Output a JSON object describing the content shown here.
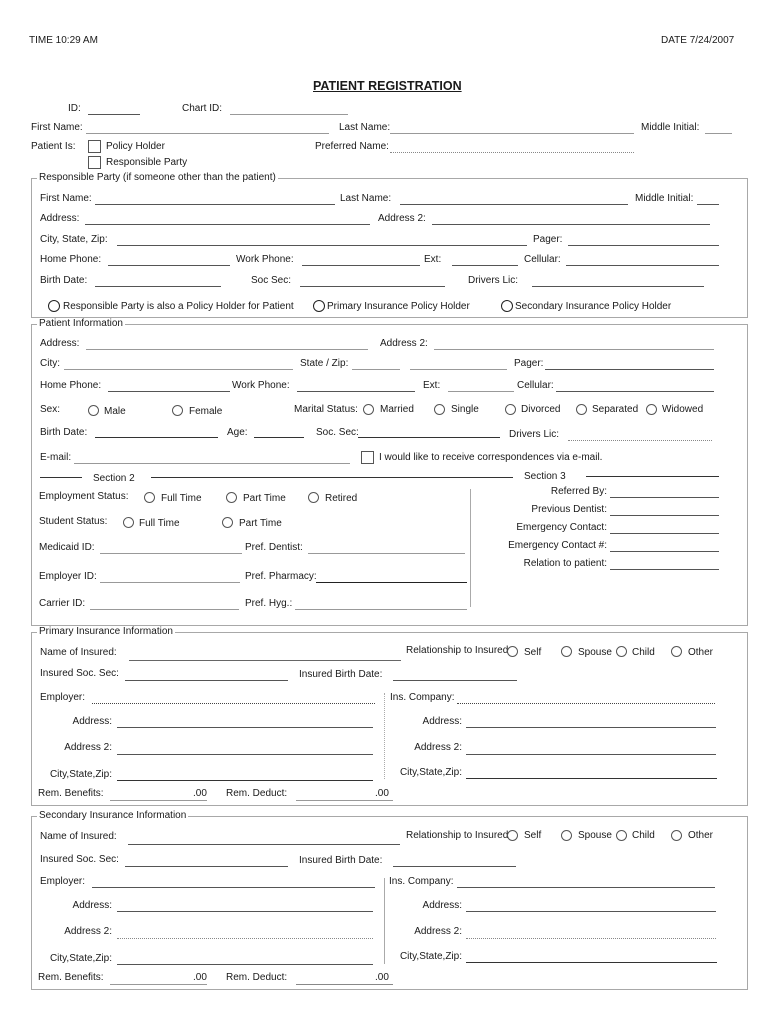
{
  "header": {
    "time": "TIME  10:29 AM",
    "date": "DATE  7/24/2007",
    "title": "PATIENT REGISTRATION"
  },
  "top": {
    "id": "ID:",
    "chart_id": "Chart ID:",
    "first_name": "First Name:",
    "last_name": "Last Name:",
    "middle_initial": "Middle Initial:",
    "patient_is": "Patient Is:",
    "policy_holder": "Policy Holder",
    "responsible_party": "Responsible Party",
    "preferred_name": "Preferred Name:"
  },
  "responsible": {
    "legend": "Responsible Party (if someone other than the patient)",
    "first_name": "First Name:",
    "last_name": "Last Name:",
    "middle_initial": "Middle Initial:",
    "address": "Address:",
    "address2": "Address 2:",
    "city_state_zip": "City, State, Zip:",
    "pager": "Pager:",
    "home_phone": "Home Phone:",
    "work_phone": "Work Phone:",
    "ext": "Ext:",
    "cellular": "Cellular:",
    "birth_date": "Birth Date:",
    "soc_sec": "Soc Sec:",
    "drivers_lic": "Drivers Lic:",
    "options": [
      "Responsible Party is also a Policy Holder for Patient",
      "Primary Insurance Policy Holder",
      "Secondary Insurance Policy Holder"
    ]
  },
  "patient": {
    "legend": "Patient Information",
    "address": "Address:",
    "address2": "Address 2:",
    "city": "City:",
    "state_zip": "State / Zip:",
    "pager": "Pager:",
    "home_phone": "Home Phone:",
    "work_phone": "Work Phone:",
    "ext": "Ext:",
    "cellular": "Cellular:",
    "sex": "Sex:",
    "sex_options": [
      "Male",
      "Female"
    ],
    "marital_status": "Marital Status:",
    "marital_options": [
      "Married",
      "Single",
      "Divorced",
      "Separated",
      "Widowed"
    ],
    "birth_date": "Birth Date:",
    "age": "Age:",
    "soc_sec": "Soc. Sec:",
    "drivers_lic": "Drivers Lic:",
    "email": "E-mail:",
    "email_opt_in": "I would like to receive correspondences via e-mail."
  },
  "section2": {
    "title": "Section 2",
    "employment_status": "Employment Status:",
    "employment_options": [
      "Full Time",
      "Part Time",
      "Retired"
    ],
    "student_status": "Student Status:",
    "student_options": [
      "Full Time",
      "Part Time"
    ],
    "medicaid_id": "Medicaid ID:",
    "pref_dentist": "Pref. Dentist:",
    "employer_id": "Employer ID:",
    "pref_pharmacy": "Pref. Pharmacy:",
    "carrier_id": "Carrier ID:",
    "pref_hyg": "Pref. Hyg.:"
  },
  "section3": {
    "title": "Section 3",
    "referred_by": "Referred By:",
    "previous_dentist": "Previous Dentist:",
    "emergency_contact": "Emergency Contact:",
    "emergency_contact_num": "Emergency Contact #:",
    "relation": "Relation to patient:"
  },
  "primary": {
    "legend": "Primary Insurance Information",
    "name_of_insured": "Name of Insured:",
    "relationship": "Relationship to Insured:",
    "rel_options": [
      "Self",
      "Spouse",
      "Child",
      "Other"
    ],
    "insured_soc_sec": "Insured Soc. Sec:",
    "insured_birth_date": "Insured Birth Date:",
    "employer": "Employer:",
    "address": "Address:",
    "address2": "Address 2:",
    "city_state_zip": "City,State,Zip:",
    "ins_company": "Ins. Company:",
    "ins_address": "Address:",
    "ins_address2": "Address 2:",
    "ins_city_state_zip": "City,State,Zip:",
    "rem_benefits": "Rem. Benefits:",
    "rem_benefits_value": ".00",
    "rem_deduct": "Rem. Deduct:",
    "rem_deduct_value": ".00"
  },
  "secondary": {
    "legend": "Secondary Insurance Information",
    "name_of_insured": "Name of Insured:",
    "relationship": "Relationship to Insured:",
    "rel_options": [
      "Self",
      "Spouse",
      "Child",
      "Other"
    ],
    "insured_soc_sec": "Insured Soc. Sec:",
    "insured_birth_date": "Insured Birth Date:",
    "employer": "Employer:",
    "address": "Address:",
    "address2": "Address 2:",
    "city_state_zip": "City,State,Zip:",
    "ins_company": "Ins. Company:",
    "ins_address": "Address:",
    "ins_address2": "Address 2:",
    "ins_city_state_zip": "City,State,Zip:",
    "rem_benefits": "Rem. Benefits:",
    "rem_benefits_value": ".00",
    "rem_deduct": "Rem. Deduct:",
    "rem_deduct_value": ".00"
  }
}
